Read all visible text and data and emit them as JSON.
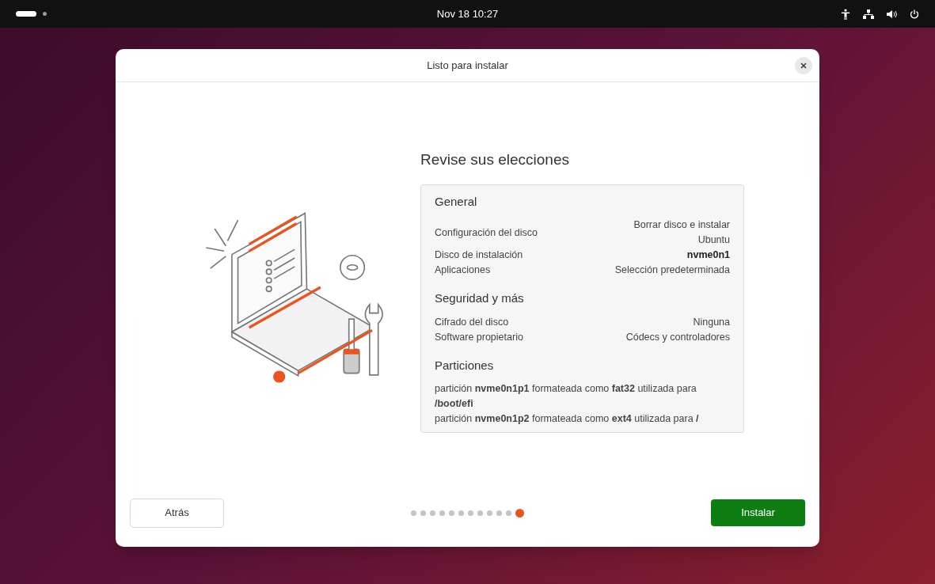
{
  "top_bar": {
    "clock": "Nov 18  10:27"
  },
  "dialog": {
    "title": "Listo para instalar",
    "heading": "Revise sus elecciones"
  },
  "sections": [
    {
      "title": "General",
      "kind": "pairs",
      "rows": [
        {
          "label": "Configuración del disco",
          "value": "Borrar disco e instalar Ubuntu",
          "bold": false
        },
        {
          "label": "Disco de instalación",
          "value": "nvme0n1",
          "bold": true
        },
        {
          "label": "Aplicaciones",
          "value": "Selección predeterminada",
          "bold": false
        }
      ]
    },
    {
      "title": "Seguridad y más",
      "kind": "pairs",
      "rows": [
        {
          "label": "Cifrado del disco",
          "value": "Ninguna",
          "bold": false
        },
        {
          "label": "Software propietario",
          "value": "Códecs y controladores",
          "bold": false
        }
      ]
    },
    {
      "title": "Particiones",
      "kind": "lines",
      "lines": [
        "partición **nvme0n1p1** formateada como **fat32** utilizada para **/boot/efi**",
        "partición **nvme0n1p2** formateada como **ext4** utilizada para **/**"
      ]
    }
  ],
  "footer": {
    "back": "Atrás",
    "install": "Instalar",
    "steps": [
      {
        "selected": false
      },
      {
        "selected": false
      },
      {
        "selected": false
      },
      {
        "selected": false
      },
      {
        "selected": false
      },
      {
        "selected": false
      },
      {
        "selected": false
      },
      {
        "selected": false
      },
      {
        "selected": false
      },
      {
        "selected": false
      },
      {
        "selected": false
      },
      {
        "selected": true
      }
    ]
  }
}
